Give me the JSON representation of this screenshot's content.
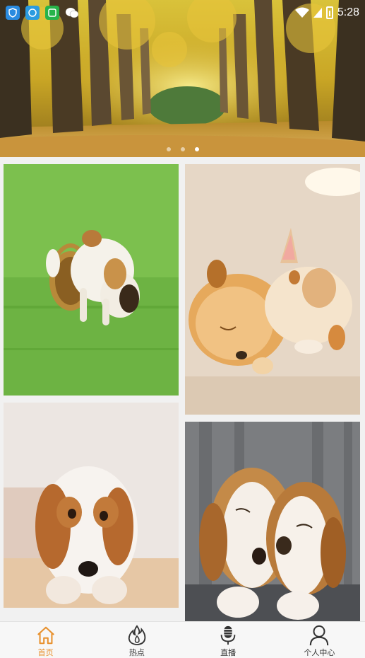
{
  "status_bar": {
    "time": "5:28",
    "icons": [
      "shield-app-icon",
      "sync-app-icon",
      "chat-app-icon",
      "wechat-icon",
      "wifi-icon",
      "signal-icon",
      "battery-icon"
    ]
  },
  "banner": {
    "image": "autumn-tree-avenue",
    "dots": 3,
    "active_dot": 2
  },
  "feed": {
    "items": [
      {
        "image": "puppy-with-basket-on-grass"
      },
      {
        "image": "puppy-and-rabbit-sleeping"
      },
      {
        "image": "beagle-puppy-lying"
      },
      {
        "image": "two-beagle-puppies-sleeping"
      }
    ]
  },
  "bottom_nav": {
    "active_color": "#e8912e",
    "items": [
      {
        "label": "首页",
        "icon": "home-icon",
        "active": true
      },
      {
        "label": "热点",
        "icon": "flame-icon",
        "active": false
      },
      {
        "label": "直播",
        "icon": "microphone-icon",
        "active": false
      },
      {
        "label": "个人中心",
        "icon": "person-icon",
        "active": false
      }
    ]
  }
}
